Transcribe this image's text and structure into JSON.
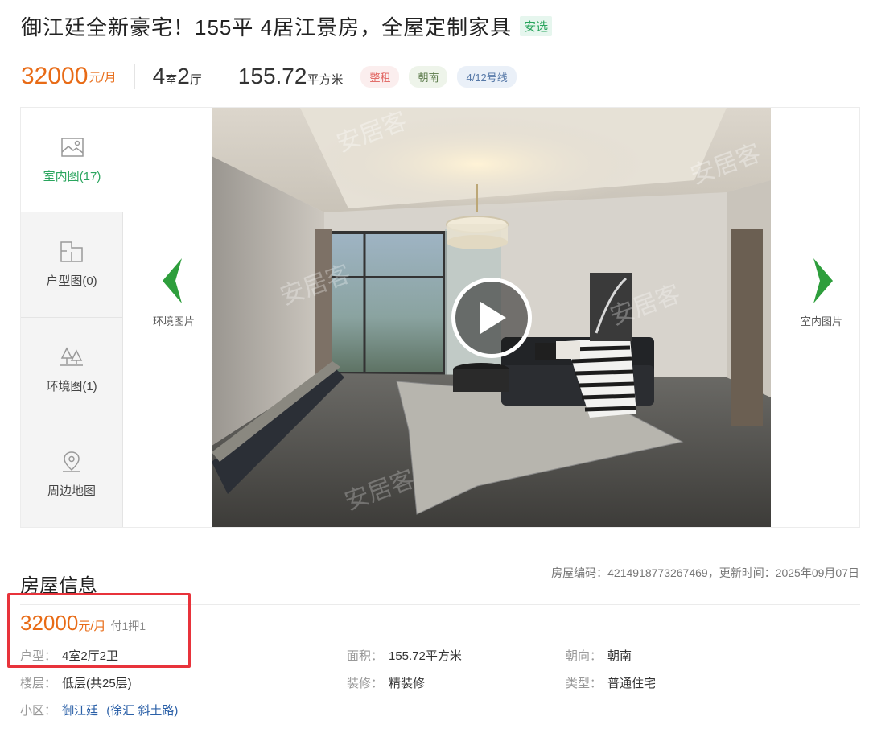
{
  "listing": {
    "title": "御江廷全新豪宅！155平 4居江景房，全屋定制家具",
    "badge": "安选"
  },
  "summary": {
    "price": "32000",
    "price_unit": "元/月",
    "rooms_num1": "4",
    "rooms_unit1": "室",
    "rooms_num2": "2",
    "rooms_unit2": "厅",
    "area_num": "155.72",
    "area_unit": "平方米",
    "tags": [
      "整租",
      "朝南",
      "4/12号线"
    ]
  },
  "gallery": {
    "tabs": [
      {
        "label": "室内图(17)",
        "icon": "image-icon"
      },
      {
        "label": "户型图(0)",
        "icon": "floorplan-icon"
      },
      {
        "label": "环境图(1)",
        "icon": "trees-icon"
      },
      {
        "label": "周边地图",
        "icon": "map-pin-icon"
      }
    ],
    "prev_label": "环境图片",
    "next_label": "室内图片",
    "arrow_color": "#2e9e3c",
    "watermark": "安居客"
  },
  "info": {
    "heading": "房屋信息",
    "meta": "房屋编码：4214918773267469，更新时间：2025年09月07日",
    "price": "32000",
    "price_unit": "元/月",
    "payment": "付1押1",
    "layout_label": "户型：",
    "layout_value": "4室2厅2卫",
    "area_label": "面积：",
    "area_value": "155.72平方米",
    "orient_label": "朝向：",
    "orient_value": "朝南",
    "floor_label": "楼层：",
    "floor_value": "低层(共25层)",
    "deco_label": "装修：",
    "deco_value": "精装修",
    "type_label": "类型：",
    "type_value": "普通住宅",
    "community_label": "小区：",
    "community_name": "御江廷",
    "community_area": "(徐汇 斜土路)"
  },
  "colors": {
    "price": "#e86b16",
    "accent_green": "#2aa55e",
    "highlight_box": "#e8333b",
    "link": "#2c61a8"
  }
}
